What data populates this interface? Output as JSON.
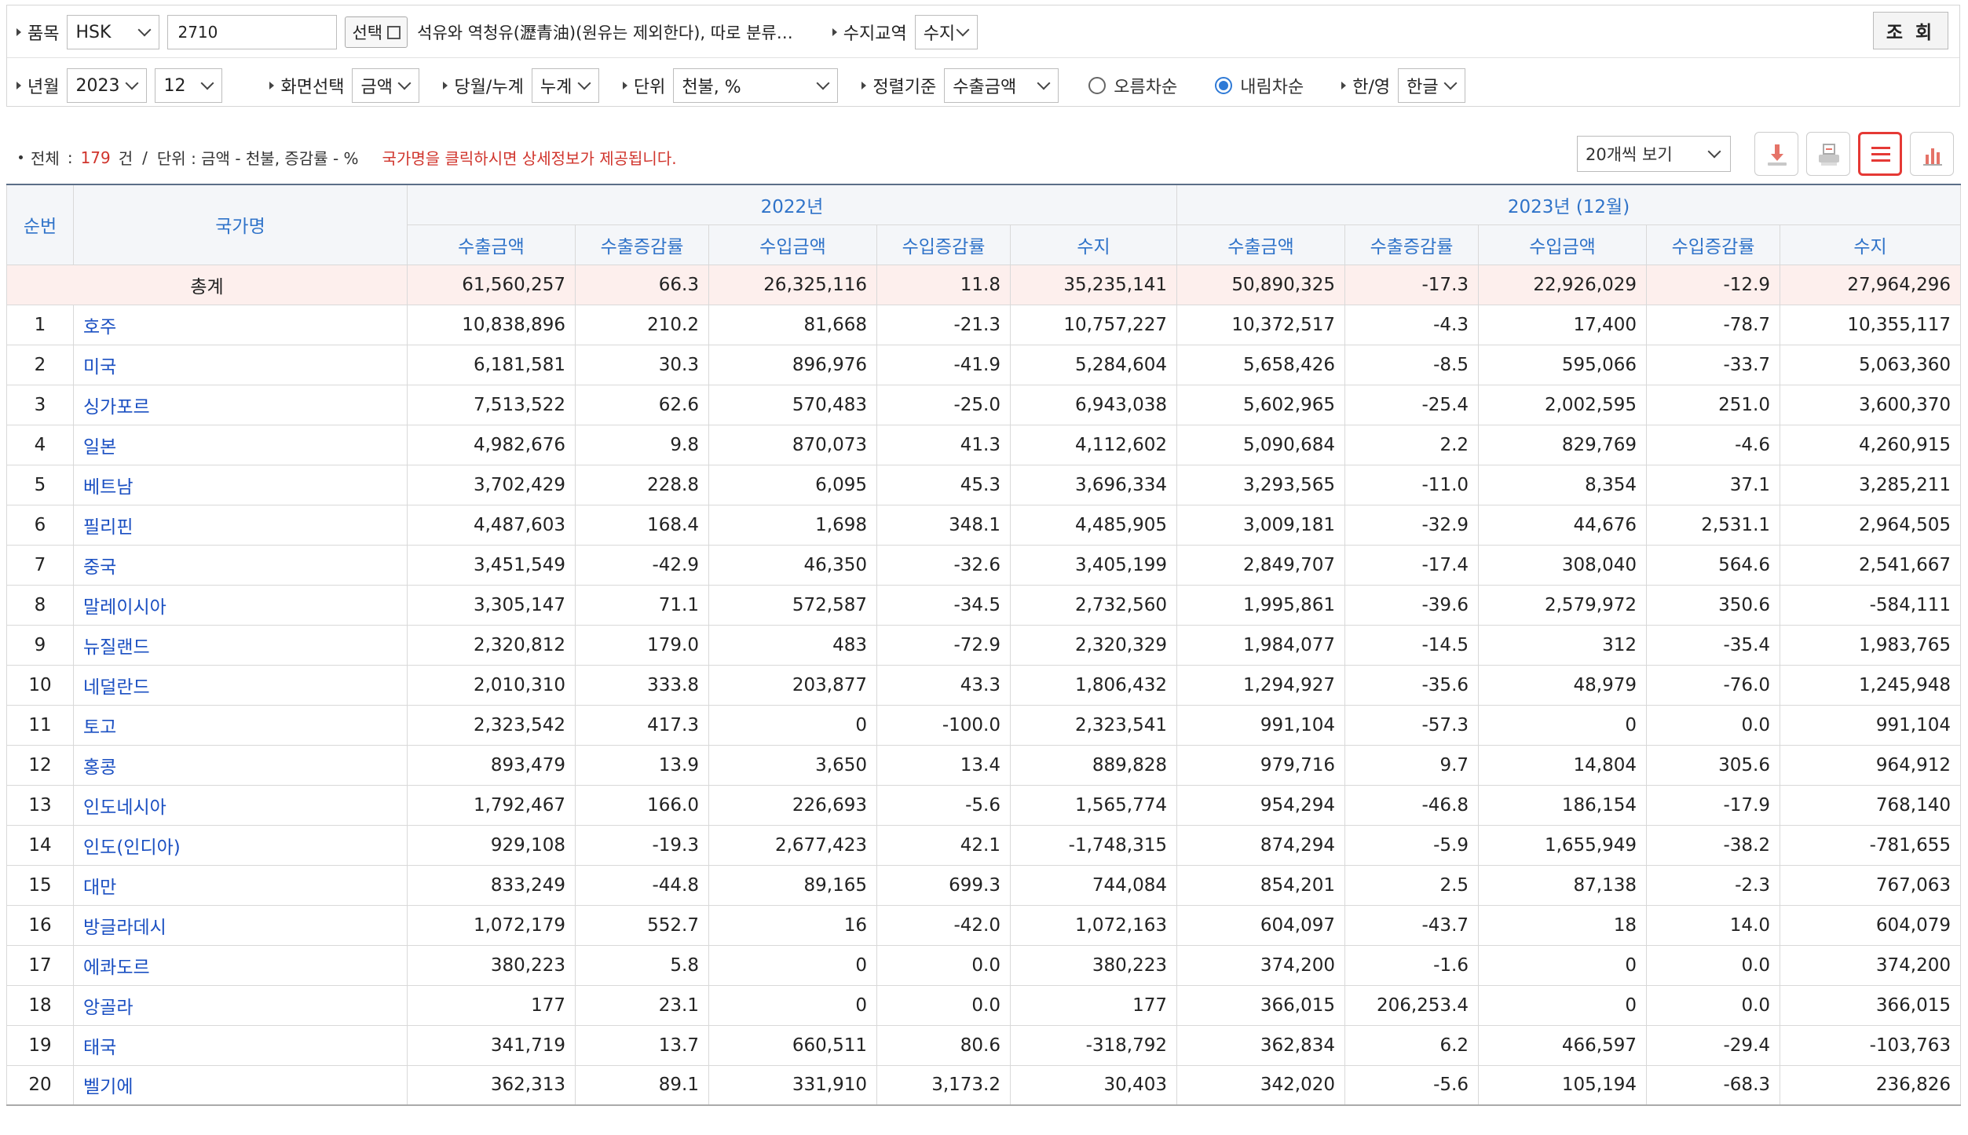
{
  "filters": {
    "item_label": "품목",
    "classification": "HSK",
    "hs_code": "2710",
    "select_button": "선택",
    "description": "석유와 역청유(瀝青油)(원유는 제외한다), 따로 분류…",
    "trade_label": "수지교역",
    "trade_value": "수지",
    "query_button": "조 회",
    "year_month_label": "년월",
    "year": "2023",
    "month": "12",
    "screen_label": "화면선택",
    "screen_value": "금액",
    "period_label": "당월/누계",
    "period_value": "누계",
    "unit_label": "단위",
    "unit_value": "천불, %",
    "sort_label": "정렬기준",
    "sort_value": "수출금액",
    "asc_label": "오름차순",
    "desc_label": "내림차순",
    "sort_order": "desc",
    "lang_label": "한/영",
    "lang_value": "한글"
  },
  "info": {
    "total_label": "전체",
    "total_count": "179",
    "count_unit": "건",
    "slash": "/",
    "unit_text": "단위 : 금액 - 천불, 증감률 - %",
    "colon": ":",
    "hint": "국가명을 클릭하시면 상세정보가 제공됩니다."
  },
  "toolbar": {
    "page_size": "20개씩 보기",
    "icons": [
      "download-icon",
      "print-icon",
      "list-view-icon",
      "chart-view-icon"
    ]
  },
  "table": {
    "rank_header": "순번",
    "country_header": "국가명",
    "period1": "2022년",
    "period2": "2023년 (12월)",
    "columns": [
      "수출금액",
      "수출증감률",
      "수입금액",
      "수입증감률",
      "수지"
    ],
    "total": {
      "label": "총계",
      "values": [
        "61,560,257",
        "66.3",
        "26,325,116",
        "11.8",
        "35,235,141",
        "50,890,325",
        "-17.3",
        "22,926,029",
        "-12.9",
        "27,964,296"
      ]
    },
    "rows": [
      {
        "rank": "1",
        "country": "호주",
        "values": [
          "10,838,896",
          "210.2",
          "81,668",
          "-21.3",
          "10,757,227",
          "10,372,517",
          "-4.3",
          "17,400",
          "-78.7",
          "10,355,117"
        ]
      },
      {
        "rank": "2",
        "country": "미국",
        "values": [
          "6,181,581",
          "30.3",
          "896,976",
          "-41.9",
          "5,284,604",
          "5,658,426",
          "-8.5",
          "595,066",
          "-33.7",
          "5,063,360"
        ]
      },
      {
        "rank": "3",
        "country": "싱가포르",
        "values": [
          "7,513,522",
          "62.6",
          "570,483",
          "-25.0",
          "6,943,038",
          "5,602,965",
          "-25.4",
          "2,002,595",
          "251.0",
          "3,600,370"
        ]
      },
      {
        "rank": "4",
        "country": "일본",
        "values": [
          "4,982,676",
          "9.8",
          "870,073",
          "41.3",
          "4,112,602",
          "5,090,684",
          "2.2",
          "829,769",
          "-4.6",
          "4,260,915"
        ]
      },
      {
        "rank": "5",
        "country": "베트남",
        "values": [
          "3,702,429",
          "228.8",
          "6,095",
          "45.3",
          "3,696,334",
          "3,293,565",
          "-11.0",
          "8,354",
          "37.1",
          "3,285,211"
        ]
      },
      {
        "rank": "6",
        "country": "필리핀",
        "values": [
          "4,487,603",
          "168.4",
          "1,698",
          "348.1",
          "4,485,905",
          "3,009,181",
          "-32.9",
          "44,676",
          "2,531.1",
          "2,964,505"
        ]
      },
      {
        "rank": "7",
        "country": "중국",
        "values": [
          "3,451,549",
          "-42.9",
          "46,350",
          "-32.6",
          "3,405,199",
          "2,849,707",
          "-17.4",
          "308,040",
          "564.6",
          "2,541,667"
        ]
      },
      {
        "rank": "8",
        "country": "말레이시아",
        "values": [
          "3,305,147",
          "71.1",
          "572,587",
          "-34.5",
          "2,732,560",
          "1,995,861",
          "-39.6",
          "2,579,972",
          "350.6",
          "-584,111"
        ]
      },
      {
        "rank": "9",
        "country": "뉴질랜드",
        "values": [
          "2,320,812",
          "179.0",
          "483",
          "-72.9",
          "2,320,329",
          "1,984,077",
          "-14.5",
          "312",
          "-35.4",
          "1,983,765"
        ]
      },
      {
        "rank": "10",
        "country": "네덜란드",
        "values": [
          "2,010,310",
          "333.8",
          "203,877",
          "43.3",
          "1,806,432",
          "1,294,927",
          "-35.6",
          "48,979",
          "-76.0",
          "1,245,948"
        ]
      },
      {
        "rank": "11",
        "country": "토고",
        "values": [
          "2,323,542",
          "417.3",
          "0",
          "-100.0",
          "2,323,541",
          "991,104",
          "-57.3",
          "0",
          "0.0",
          "991,104"
        ]
      },
      {
        "rank": "12",
        "country": "홍콩",
        "values": [
          "893,479",
          "13.9",
          "3,650",
          "13.4",
          "889,828",
          "979,716",
          "9.7",
          "14,804",
          "305.6",
          "964,912"
        ]
      },
      {
        "rank": "13",
        "country": "인도네시아",
        "values": [
          "1,792,467",
          "166.0",
          "226,693",
          "-5.6",
          "1,565,774",
          "954,294",
          "-46.8",
          "186,154",
          "-17.9",
          "768,140"
        ]
      },
      {
        "rank": "14",
        "country": "인도(인디아)",
        "values": [
          "929,108",
          "-19.3",
          "2,677,423",
          "42.1",
          "-1,748,315",
          "874,294",
          "-5.9",
          "1,655,949",
          "-38.2",
          "-781,655"
        ]
      },
      {
        "rank": "15",
        "country": "대만",
        "values": [
          "833,249",
          "-44.8",
          "89,165",
          "699.3",
          "744,084",
          "854,201",
          "2.5",
          "87,138",
          "-2.3",
          "767,063"
        ]
      },
      {
        "rank": "16",
        "country": "방글라데시",
        "values": [
          "1,072,179",
          "552.7",
          "16",
          "-42.0",
          "1,072,163",
          "604,097",
          "-43.7",
          "18",
          "14.0",
          "604,079"
        ]
      },
      {
        "rank": "17",
        "country": "에콰도르",
        "values": [
          "380,223",
          "5.8",
          "0",
          "0.0",
          "380,223",
          "374,200",
          "-1.6",
          "0",
          "0.0",
          "374,200"
        ]
      },
      {
        "rank": "18",
        "country": "앙골라",
        "values": [
          "177",
          "23.1",
          "0",
          "0.0",
          "177",
          "366,015",
          "206,253.4",
          "0",
          "0.0",
          "366,015"
        ]
      },
      {
        "rank": "19",
        "country": "태국",
        "values": [
          "341,719",
          "13.7",
          "660,511",
          "80.6",
          "-318,792",
          "362,834",
          "6.2",
          "466,597",
          "-29.4",
          "-103,763"
        ]
      },
      {
        "rank": "20",
        "country": "벨기에",
        "values": [
          "362,313",
          "89.1",
          "331,910",
          "3,173.2",
          "30,403",
          "342,020",
          "-5.6",
          "105,194",
          "-68.3",
          "236,826"
        ]
      }
    ]
  },
  "colors": {
    "accent_blue": "#2f73c9",
    "link_blue": "#1a4fc2",
    "alert_red": "#d0342c",
    "total_row_bg": "#fdefed",
    "header_bg": "#f4f6f9"
  }
}
